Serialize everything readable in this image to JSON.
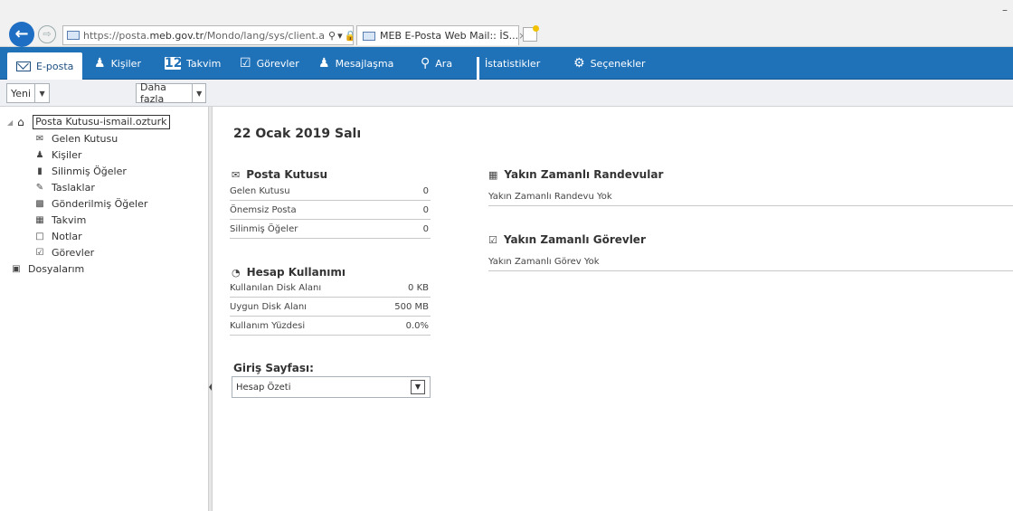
{
  "browser": {
    "url_prefix": "https://posta.",
    "url_domain": "meb.gov.tr",
    "url_path": "/Mondo/lang/sys/client.a",
    "tab_title": "MEB E-Posta Web Mail:: İS...",
    "tab_close": "×",
    "minimize": "–"
  },
  "nav": {
    "items": [
      {
        "label": "E-posta",
        "icon": "envelope-icon"
      },
      {
        "label": "Kişiler",
        "icon": "person-icon"
      },
      {
        "label": "Takvim",
        "icon": "calendar-icon",
        "icon_text": "12"
      },
      {
        "label": "Görevler",
        "icon": "tasks-icon"
      },
      {
        "label": "Mesajlaşma",
        "icon": "chat-icon"
      },
      {
        "label": "Ara",
        "icon": "search-icon"
      },
      {
        "label": "İstatistikler",
        "icon": "chart-icon"
      },
      {
        "label": "Seçenekler",
        "icon": "gear-icon"
      }
    ]
  },
  "toolbar": {
    "new_label": "Yeni",
    "more_label": "Daha fazla"
  },
  "sidebar": {
    "root": "Posta Kutusu-ismail.ozturk",
    "items": [
      {
        "label": "Gelen Kutusu",
        "icon": "envelope-icon"
      },
      {
        "label": "Kişiler",
        "icon": "person-icon"
      },
      {
        "label": "Silinmiş Öğeler",
        "icon": "trash-icon"
      },
      {
        "label": "Taslaklar",
        "icon": "draft-icon"
      },
      {
        "label": "Gönderilmiş Öğeler",
        "icon": "sent-icon"
      },
      {
        "label": "Takvim",
        "icon": "calendar-icon"
      },
      {
        "label": "Notlar",
        "icon": "note-icon"
      },
      {
        "label": "Görevler",
        "icon": "tasks-icon"
      }
    ],
    "files": "Dosyalarım"
  },
  "main": {
    "date": "22 Ocak 2019 Salı",
    "mailbox": {
      "title": "Posta Kutusu",
      "rows": [
        {
          "label": "Gelen Kutusu",
          "value": "0"
        },
        {
          "label": "Önemsiz Posta",
          "value": "0"
        },
        {
          "label": "Silinmiş Öğeler",
          "value": "0"
        }
      ]
    },
    "account": {
      "title": "Hesap Kullanımı",
      "rows": [
        {
          "label": "Kullanılan Disk Alanı",
          "value": "0 KB"
        },
        {
          "label": "Uygun Disk Alanı",
          "value": "500 MB"
        },
        {
          "label": "Kullanım Yüzdesi",
          "value": "0.0%"
        }
      ]
    },
    "home_page": {
      "title": "Giriş Sayfası:",
      "selected": "Hesap Özeti"
    },
    "appointments": {
      "title": "Yakın Zamanlı Randevular",
      "empty": "Yakın Zamanlı Randevu Yok"
    },
    "tasks": {
      "title": "Yakın Zamanlı Görevler",
      "empty": "Yakın Zamanlı Görev Yok"
    }
  },
  "colors": {
    "nav_bg": "#1f71b8",
    "toolbar_bg": "#eef0f3"
  }
}
